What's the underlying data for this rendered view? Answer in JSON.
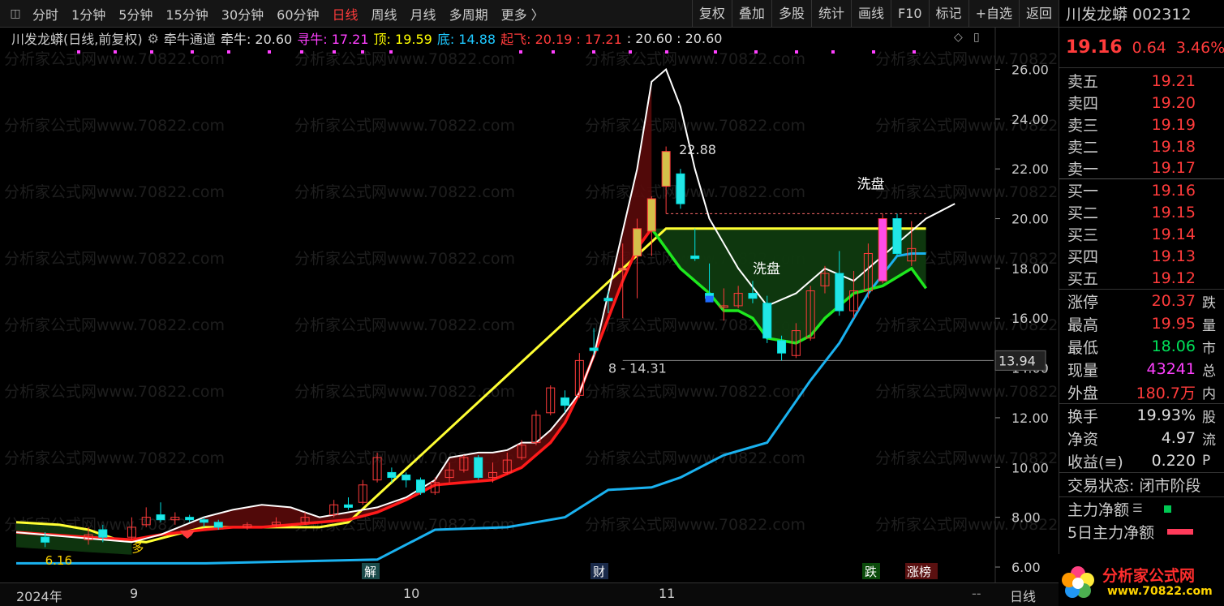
{
  "toolbar": {
    "periods": [
      "分时",
      "1分钟",
      "5分钟",
      "15分钟",
      "30分钟",
      "60分钟",
      "日线",
      "周线",
      "月线",
      "多周期",
      "更多 〉"
    ],
    "active_index": 6,
    "right_buttons": [
      "复权",
      "叠加",
      "多股",
      "统计",
      "画线",
      "F10",
      "标记",
      "+自选",
      "返回"
    ]
  },
  "legend": {
    "stock": "川发龙蟒(日线,前复权)",
    "indicator": "牵牛通道",
    "qianniu_label": "牵牛: 20.60",
    "xunniu_label": "寻牛: 17.21",
    "ding_label": "顶: 19.59",
    "di_label": "底: 14.88",
    "qifei_label": "起飞: 20.19 : 17.21",
    "extra": ": 20.60 : 20.60"
  },
  "colors": {
    "up": "#ff3b3b",
    "down": "#00ff7f",
    "xunniu": "#ff40ff",
    "ding": "#ffff00",
    "di": "#1ec8ff",
    "qifei": "#ff3b3b",
    "white_line": "#ffffff",
    "red_line": "#ff1a1a",
    "blue_line": "#1ab2f0",
    "green_line": "#1ee81e",
    "yellow_line": "#ffff33"
  },
  "chart_data": {
    "type": "line",
    "ylim": [
      6,
      26.7
    ],
    "yticks": [
      "26.00",
      "24.00",
      "22.00",
      "20.00",
      "18.00",
      "16.00",
      "14.00",
      "12.00",
      "10.00",
      "8.00",
      "6.00"
    ],
    "xlabels": [
      "2024年",
      "9",
      "10",
      "11"
    ],
    "series": [
      {
        "name": "白线",
        "x": [
          0,
          4,
          8,
          10,
          13,
          15,
          17,
          19,
          21,
          23,
          25,
          27,
          29,
          30,
          32,
          33,
          34,
          35,
          36,
          37,
          38,
          39,
          40,
          41,
          43,
          44,
          45,
          46,
          47,
          48,
          50,
          52,
          54,
          56,
          58,
          60,
          62,
          63,
          64,
          65
        ],
        "values": [
          7.4,
          7.2,
          7.0,
          7.3,
          8.0,
          8.3,
          8.5,
          8.4,
          8.0,
          8.2,
          8.4,
          8.8,
          9.5,
          10.4,
          10.6,
          10.6,
          10.7,
          11.0,
          11.0,
          11.5,
          12.2,
          13.0,
          14.5,
          17.0,
          22.0,
          25.5,
          26.0,
          24.5,
          22.0,
          20.0,
          18.0,
          16.5,
          17.0,
          18.0,
          17.5,
          18.5,
          19.5,
          20.0,
          20.3,
          20.6
        ]
      },
      {
        "name": "红线",
        "x": [
          0,
          5,
          8,
          10,
          13,
          15,
          17,
          19,
          21,
          23,
          25,
          27,
          29,
          31,
          33,
          35,
          37,
          38,
          39,
          40,
          41,
          42,
          43,
          44
        ],
        "values": [
          7.4,
          7.2,
          7.1,
          7.3,
          7.5,
          7.6,
          7.6,
          7.7,
          7.8,
          7.9,
          8.2,
          8.7,
          9.3,
          9.4,
          9.5,
          10.0,
          11.0,
          11.8,
          13.0,
          14.5,
          16.0,
          17.5,
          18.8,
          19.6
        ]
      },
      {
        "name": "蓝线",
        "x": [
          0,
          13,
          25,
          29,
          34,
          38,
          41,
          44,
          46,
          49,
          52,
          55,
          57,
          59,
          61,
          62,
          63
        ],
        "values": [
          6.15,
          6.15,
          6.3,
          7.5,
          7.6,
          8.0,
          9.1,
          9.2,
          9.6,
          10.5,
          11.0,
          13.5,
          15.0,
          17.0,
          18.5,
          18.6,
          18.6
        ]
      },
      {
        "name": "绿线",
        "x": [
          44,
          46,
          48,
          49,
          50,
          51,
          52,
          54,
          55,
          56,
          57,
          58,
          60,
          62,
          63
        ],
        "values": [
          19.6,
          18.0,
          17.0,
          16.3,
          16.3,
          16.0,
          15.2,
          15.0,
          15.3,
          16.0,
          16.5,
          17.0,
          17.3,
          18.0,
          17.2
        ]
      },
      {
        "name": "黄线",
        "x": [
          0,
          3,
          5,
          7,
          9,
          11,
          13,
          15,
          17,
          19,
          21,
          23,
          45,
          63
        ],
        "values": [
          7.8,
          7.7,
          7.5,
          7.1,
          7.0,
          7.3,
          7.6,
          7.6,
          7.6,
          7.6,
          7.6,
          7.8,
          19.6,
          19.6
        ]
      }
    ],
    "candles": [
      {
        "x": 2,
        "o": 7.2,
        "c": 7.0,
        "h": 7.4,
        "l": 6.8
      },
      {
        "x": 5,
        "o": 7.1,
        "c": 7.3,
        "h": 7.6,
        "l": 6.9
      },
      {
        "x": 6,
        "o": 7.5,
        "c": 7.2,
        "h": 7.7,
        "l": 7.0
      },
      {
        "x": 8,
        "o": 7.2,
        "c": 7.6,
        "h": 8.0,
        "l": 7.1
      },
      {
        "x": 9,
        "o": 7.7,
        "c": 8.0,
        "h": 8.4,
        "l": 7.6
      },
      {
        "x": 10,
        "o": 8.1,
        "c": 7.9,
        "h": 8.6,
        "l": 7.8
      },
      {
        "x": 11,
        "o": 7.9,
        "c": 8.0,
        "h": 8.2,
        "l": 7.7
      },
      {
        "x": 12,
        "o": 8.0,
        "c": 7.9,
        "h": 8.1,
        "l": 7.8
      },
      {
        "x": 13,
        "o": 7.9,
        "c": 7.8,
        "h": 8.0,
        "l": 7.6
      },
      {
        "x": 14,
        "o": 7.8,
        "c": 7.6,
        "h": 7.9,
        "l": 7.5
      },
      {
        "x": 16,
        "o": 7.6,
        "c": 7.7,
        "h": 7.8,
        "l": 7.5
      },
      {
        "x": 18,
        "o": 7.7,
        "c": 7.8,
        "h": 8.0,
        "l": 7.6
      },
      {
        "x": 20,
        "o": 7.8,
        "c": 8.0,
        "h": 8.2,
        "l": 7.7
      },
      {
        "x": 22,
        "o": 8.1,
        "c": 8.5,
        "h": 8.7,
        "l": 8.0
      },
      {
        "x": 23,
        "o": 8.5,
        "c": 8.4,
        "h": 8.8,
        "l": 8.3
      },
      {
        "x": 24,
        "o": 8.6,
        "c": 9.3,
        "h": 9.5,
        "l": 8.5
      },
      {
        "x": 25,
        "o": 9.5,
        "c": 10.4,
        "h": 10.6,
        "l": 9.4
      },
      {
        "x": 26,
        "o": 9.8,
        "c": 9.6,
        "h": 10.0,
        "l": 9.4
      },
      {
        "x": 27,
        "o": 9.7,
        "c": 9.5,
        "h": 9.8,
        "l": 9.2
      },
      {
        "x": 28,
        "o": 9.5,
        "c": 9.0,
        "h": 9.6,
        "l": 8.9
      },
      {
        "x": 29,
        "o": 9.0,
        "c": 9.4,
        "h": 9.6,
        "l": 8.9
      },
      {
        "x": 30,
        "o": 9.6,
        "c": 9.9,
        "h": 10.2,
        "l": 9.4
      },
      {
        "x": 31,
        "o": 9.9,
        "c": 10.4,
        "h": 10.5,
        "l": 9.8
      },
      {
        "x": 32,
        "o": 10.4,
        "c": 9.6,
        "h": 10.5,
        "l": 9.5
      },
      {
        "x": 33,
        "o": 9.6,
        "c": 9.8,
        "h": 10.2,
        "l": 9.4
      },
      {
        "x": 34,
        "o": 9.8,
        "c": 10.3,
        "h": 10.6,
        "l": 9.7
      },
      {
        "x": 35,
        "o": 10.4,
        "c": 10.9,
        "h": 11.1,
        "l": 10.3
      },
      {
        "x": 36,
        "o": 11.0,
        "c": 12.1,
        "h": 12.3,
        "l": 10.9
      },
      {
        "x": 37,
        "o": 12.2,
        "c": 13.2,
        "h": 13.3,
        "l": 12.1
      },
      {
        "x": 38,
        "o": 12.8,
        "c": 12.5,
        "h": 13.1,
        "l": 12.2
      },
      {
        "x": 39,
        "o": 12.9,
        "c": 14.3,
        "h": 14.6,
        "l": 12.8
      },
      {
        "x": 40,
        "o": 14.8,
        "c": 14.7,
        "h": 15.6,
        "l": 14.5
      },
      {
        "x": 41,
        "o": 16.8,
        "c": 16.7,
        "h": 17.1,
        "l": 16.2
      },
      {
        "x": 42,
        "o": 18.0,
        "c": 18.0,
        "h": 19.0,
        "l": 16.0
      },
      {
        "x": 43,
        "o": 18.5,
        "c": 19.6,
        "h": 20.0,
        "l": 16.8
      },
      {
        "x": 44,
        "o": 19.5,
        "c": 20.8,
        "h": 20.9,
        "l": 18.5
      },
      {
        "x": 45,
        "o": 21.3,
        "c": 22.7,
        "h": 22.9,
        "l": 20.2
      },
      {
        "x": 46,
        "o": 21.8,
        "c": 20.6,
        "h": 22.0,
        "l": 20.4
      },
      {
        "x": 47,
        "o": 18.5,
        "c": 18.4,
        "h": 19.6,
        "l": 18.3
      },
      {
        "x": 48,
        "o": 17.0,
        "c": 16.8,
        "h": 18.2,
        "l": 16.7
      },
      {
        "x": 49,
        "o": 16.5,
        "c": 16.5,
        "h": 17.2,
        "l": 15.9
      },
      {
        "x": 50,
        "o": 16.5,
        "c": 17.0,
        "h": 17.3,
        "l": 16.4
      },
      {
        "x": 51,
        "o": 17.0,
        "c": 16.8,
        "h": 17.5,
        "l": 16.6
      },
      {
        "x": 52,
        "o": 16.6,
        "c": 15.2,
        "h": 16.9,
        "l": 15.0
      },
      {
        "x": 53,
        "o": 15.1,
        "c": 14.6,
        "h": 15.3,
        "l": 14.3
      },
      {
        "x": 54,
        "o": 14.5,
        "c": 15.5,
        "h": 15.8,
        "l": 14.4
      },
      {
        "x": 55,
        "o": 15.2,
        "c": 17.1,
        "h": 17.3,
        "l": 15.1
      },
      {
        "x": 56,
        "o": 17.3,
        "c": 17.8,
        "h": 18.1,
        "l": 17.0
      },
      {
        "x": 57,
        "o": 17.8,
        "c": 16.3,
        "h": 18.7,
        "l": 16.1
      },
      {
        "x": 58,
        "o": 16.3,
        "c": 17.1,
        "h": 17.9,
        "l": 16.0
      },
      {
        "x": 59,
        "o": 17.1,
        "c": 18.6,
        "h": 19.0,
        "l": 16.8
      },
      {
        "x": 60,
        "o": 17.5,
        "c": 20.0,
        "h": 20.2,
        "l": 17.4
      },
      {
        "x": 61,
        "o": 20.0,
        "c": 18.6,
        "h": 20.2,
        "l": 18.5
      },
      {
        "x": 62,
        "o": 18.3,
        "c": 18.8,
        "h": 19.9,
        "l": 18.1
      }
    ],
    "annotations": {
      "peak": "22.88",
      "low_range": "8 - 14.31",
      "wash_label": "洗盘",
      "wash_label_2": "洗盘",
      "price_level": "13.94",
      "min_label": "6.16",
      "duo_label": "多",
      "jie": "解",
      "cai": "财",
      "die": "跌",
      "zhangbang": "涨榜"
    }
  },
  "sidebar": {
    "title": "川发龙蟒 002312",
    "price": "19.16",
    "change": "0.64",
    "pct": "3.46%",
    "asks": [
      {
        "label": "卖五",
        "price": "19.21"
      },
      {
        "label": "卖四",
        "price": "19.20"
      },
      {
        "label": "卖三",
        "price": "19.19"
      },
      {
        "label": "卖二",
        "price": "19.18"
      },
      {
        "label": "卖一",
        "price": "19.17"
      }
    ],
    "bids": [
      {
        "label": "买一",
        "price": "19.16"
      },
      {
        "label": "买二",
        "price": "19.15"
      },
      {
        "label": "买三",
        "price": "19.14"
      },
      {
        "label": "买四",
        "price": "19.13"
      },
      {
        "label": "买五",
        "price": "19.12"
      }
    ],
    "stats": [
      {
        "label": "涨停",
        "value": "20.37",
        "ext": "跌",
        "color": "#ff3b3b"
      },
      {
        "label": "最高",
        "value": "19.95",
        "ext": "量",
        "color": "#ff3b3b"
      },
      {
        "label": "最低",
        "value": "18.06",
        "ext": "市",
        "color": "#00e35a"
      },
      {
        "label": "现量",
        "value": "43241",
        "ext": "总",
        "color": "#ff40ff"
      },
      {
        "label": "外盘",
        "value": "180.7万",
        "ext": "内",
        "color": "#ff3b3b"
      }
    ],
    "stats2": [
      {
        "label": "换手",
        "value": "19.93%",
        "ext": "股"
      },
      {
        "label": "净资",
        "value": "4.97",
        "ext": "流"
      },
      {
        "label": "收益(≡)",
        "value": "0.220",
        "ext": "P"
      }
    ],
    "status": "交易状态: 闭市阶段",
    "zhuli": "主力净额",
    "zhuli5": "5日主力净额",
    "logo_text": "分析家公式网",
    "logo_url": "www.70822.com"
  },
  "bottom": {
    "period_label": "日线",
    "dash": "--"
  },
  "watermark": "分析家公式网www.70822.com"
}
